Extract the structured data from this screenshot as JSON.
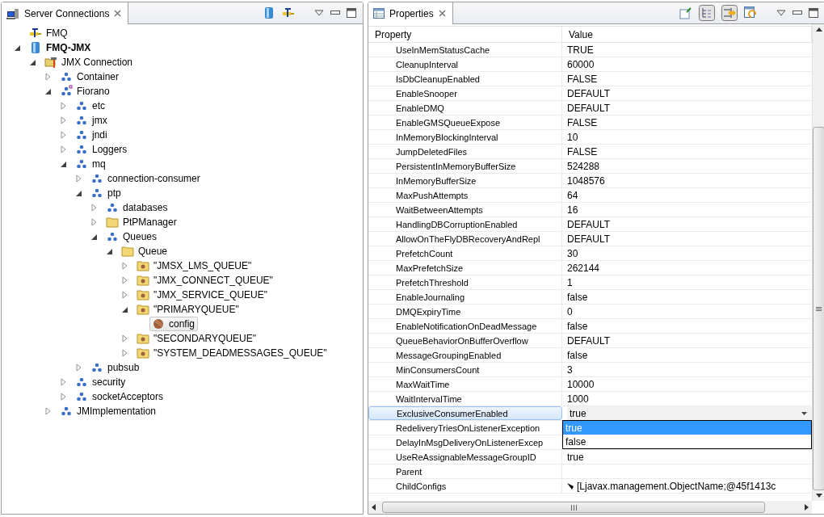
{
  "server_connections": {
    "title": "Server Connections",
    "tree": [
      {
        "label": "FMQ",
        "kind": "plug",
        "active": false,
        "selected": false
      },
      {
        "label": "FMQ-JMX",
        "kind": "server",
        "active": true,
        "selected": false,
        "expanded": true,
        "children": [
          {
            "label": "JMX Connection",
            "kind": "connection",
            "selected": false,
            "expanded": true,
            "children": [
              {
                "label": "Container",
                "kind": "nodes",
                "selected": false,
                "expanded": false
              },
              {
                "label": "Fiorano",
                "kind": "nodes-marked",
                "selected": false,
                "expanded": true,
                "children": [
                  {
                    "label": "etc",
                    "kind": "nodes",
                    "selected": false,
                    "expanded": false
                  },
                  {
                    "label": "jmx",
                    "kind": "nodes",
                    "selected": false,
                    "expanded": false
                  },
                  {
                    "label": "jndi",
                    "kind": "nodes",
                    "selected": false,
                    "expanded": false
                  },
                  {
                    "label": "Loggers",
                    "kind": "nodes",
                    "selected": false,
                    "expanded": false
                  },
                  {
                    "label": "mq",
                    "kind": "nodes",
                    "selected": false,
                    "expanded": true,
                    "children": [
                      {
                        "label": "connection-consumer",
                        "kind": "nodes",
                        "selected": false,
                        "expanded": false
                      },
                      {
                        "label": "ptp",
                        "kind": "nodes",
                        "selected": false,
                        "expanded": true,
                        "children": [
                          {
                            "label": "databases",
                            "kind": "nodes",
                            "selected": false,
                            "expanded": false
                          },
                          {
                            "label": "PtPManager",
                            "kind": "folder",
                            "selected": false,
                            "expanded": false
                          },
                          {
                            "label": "Queues",
                            "kind": "nodes",
                            "selected": false,
                            "expanded": true,
                            "children": [
                              {
                                "label": "Queue",
                                "kind": "folder",
                                "selected": false,
                                "expanded": true,
                                "children": [
                                  {
                                    "label": "\"JMSX_LMS_QUEUE\"",
                                    "kind": "queue",
                                    "selected": false,
                                    "expanded": false
                                  },
                                  {
                                    "label": "\"JMX_CONNECT_QUEUE\"",
                                    "kind": "queue",
                                    "selected": false,
                                    "expanded": false
                                  },
                                  {
                                    "label": "\"JMX_SERVICE_QUEUE\"",
                                    "kind": "queue",
                                    "selected": false,
                                    "expanded": false
                                  },
                                  {
                                    "label": "\"PRIMARYQUEUE\"",
                                    "kind": "queue",
                                    "selected": false,
                                    "expanded": true,
                                    "children": [
                                      {
                                        "label": "config",
                                        "kind": "config",
                                        "selected": true
                                      }
                                    ]
                                  },
                                  {
                                    "label": "\"SECONDARYQUEUE\"",
                                    "kind": "queue",
                                    "selected": false,
                                    "expanded": false
                                  },
                                  {
                                    "label": "\"SYSTEM_DEADMESSAGES_QUEUE\"",
                                    "kind": "queue",
                                    "selected": false,
                                    "expanded": false
                                  }
                                ]
                              }
                            ]
                          }
                        ]
                      },
                      {
                        "label": "pubsub",
                        "kind": "nodes",
                        "selected": false,
                        "expanded": false
                      }
                    ]
                  },
                  {
                    "label": "security",
                    "kind": "nodes",
                    "selected": false,
                    "expanded": false
                  },
                  {
                    "label": "socketAcceptors",
                    "kind": "nodes",
                    "selected": false,
                    "expanded": false
                  }
                ]
              },
              {
                "label": "JMImplementation",
                "kind": "nodes",
                "selected": false,
                "expanded": false
              }
            ]
          }
        ]
      }
    ]
  },
  "properties": {
    "title": "Properties",
    "columns": [
      "Property",
      "Value"
    ],
    "rows": [
      {
        "kind": "text",
        "name": "UseInMemStatusCache",
        "value": "TRUE",
        "selected": false
      },
      {
        "kind": "text",
        "name": "CleanupInterval",
        "value": "60000",
        "selected": false
      },
      {
        "kind": "text",
        "name": "IsDbCleanupEnabled",
        "value": "FALSE",
        "selected": false
      },
      {
        "kind": "text",
        "name": "EnableSnooper",
        "value": "DEFAULT",
        "selected": false
      },
      {
        "kind": "text",
        "name": "EnableDMQ",
        "value": "DEFAULT",
        "selected": false
      },
      {
        "kind": "text",
        "name": "EnableGMSQueueExpose",
        "value": "FALSE",
        "selected": false
      },
      {
        "kind": "text",
        "name": "InMemoryBlockingInterval",
        "value": "10",
        "selected": false
      },
      {
        "kind": "text",
        "name": "JumpDeletedFiles",
        "value": "FALSE",
        "selected": false
      },
      {
        "kind": "text",
        "name": "PersistentInMemoryBufferSize",
        "value": "524288",
        "selected": false
      },
      {
        "kind": "text",
        "name": "InMemoryBufferSize",
        "value": "1048576",
        "selected": false
      },
      {
        "kind": "text",
        "name": "MaxPushAttempts",
        "value": "64",
        "selected": false
      },
      {
        "kind": "text",
        "name": "WaitBetweenAttempts",
        "value": "16",
        "selected": false
      },
      {
        "kind": "text",
        "name": "HandlingDBCorruptionEnabled",
        "value": "DEFAULT",
        "selected": false
      },
      {
        "kind": "text",
        "name": "AllowOnTheFlyDBRecoveryAndRepl",
        "value": "DEFAULT",
        "selected": false
      },
      {
        "kind": "text",
        "name": "PrefetchCount",
        "value": "30",
        "selected": false
      },
      {
        "kind": "text",
        "name": "MaxPrefetchSize",
        "value": "262144",
        "selected": false
      },
      {
        "kind": "text",
        "name": "PrefetchThreshold",
        "value": "1",
        "selected": false
      },
      {
        "kind": "text",
        "name": "EnableJournaling",
        "value": "false",
        "selected": false
      },
      {
        "kind": "text",
        "name": "DMQExpiryTime",
        "value": "0",
        "selected": false
      },
      {
        "kind": "text",
        "name": "EnableNotificationOnDeadMessage",
        "value": "false",
        "selected": false
      },
      {
        "kind": "text",
        "name": "QueueBehaviorOnBufferOverflow",
        "value": "DEFAULT",
        "selected": false
      },
      {
        "kind": "text",
        "name": "MessageGroupingEnabled",
        "value": "false",
        "selected": false
      },
      {
        "kind": "text",
        "name": "MinConsumersCount",
        "value": "3",
        "selected": false
      },
      {
        "kind": "text",
        "name": "MaxWaitTime",
        "value": "10000",
        "selected": false
      },
      {
        "kind": "text",
        "name": "WaitIntervalTime",
        "value": "1000",
        "selected": false
      },
      {
        "kind": "combo",
        "name": "ExclusiveConsumerEnabled",
        "value": "true",
        "selected": true,
        "options": [
          {
            "label": "true",
            "selected": true
          },
          {
            "label": "false",
            "selected": false
          }
        ]
      },
      {
        "kind": "text",
        "name": "RedeliveryTriesOnListenerException",
        "selected": false
      },
      {
        "kind": "text",
        "name": "DelayInMsgDeliveryOnListenerExcep",
        "selected": false
      },
      {
        "kind": "text",
        "name": "UseReAssignableMessageGroupID",
        "value": "true",
        "selected": false
      },
      {
        "kind": "text",
        "name": "Parent",
        "selected": false
      },
      {
        "kind": "expandable",
        "name": "ChildConfigs",
        "value": "[Ljavax.management.ObjectName;@45f1413c",
        "expanded": false,
        "selected": false
      }
    ]
  }
}
